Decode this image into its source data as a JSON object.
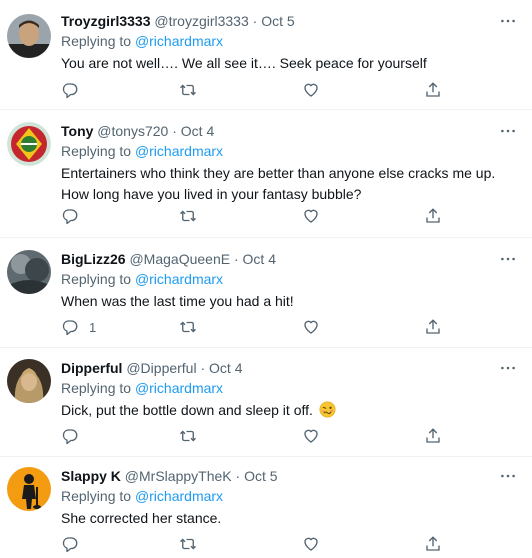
{
  "tweets": [
    {
      "name": "Troyzgirl3333",
      "handle": "@troyzgirl3333",
      "date": "Oct 5",
      "reply_prefix": "Replying to ",
      "mention": "@richardmarx",
      "text": "You are not well…. We all see it…. Seek peace for yourself",
      "reply_count": ""
    },
    {
      "name": "Tony",
      "handle": "@tonys720",
      "date": "Oct 4",
      "reply_prefix": "Replying to ",
      "mention": "@richardmarx",
      "text": "Entertainers who think they are better than anyone else cracks me up. How long have you lived in your fantasy bubble?",
      "reply_count": ""
    },
    {
      "name": "BigLizz26",
      "handle": "@MagaQueenE",
      "date": "Oct 4",
      "reply_prefix": "Replying to ",
      "mention": "@richardmarx",
      "text": "When was the last time you had a hit!",
      "reply_count": "1"
    },
    {
      "name": "Dipperful",
      "handle": "@Dipperful",
      "date": "Oct 4",
      "reply_prefix": "Replying to ",
      "mention": "@richardmarx",
      "text": "Dick, put the bottle down and sleep it off.",
      "reply_count": ""
    },
    {
      "name": "Slappy K",
      "handle": "@MrSlappyTheK",
      "date": "Oct 5",
      "reply_prefix": "Replying to ",
      "mention": "@richardmarx",
      "text": "She corrected her stance.",
      "reply_count": ""
    }
  ],
  "separator": "·",
  "colors": {
    "accent": "#1d9bf0",
    "secondary": "#536471",
    "text": "#0f1419"
  },
  "icons": [
    "more-icon",
    "reply-icon",
    "retweet-icon",
    "like-icon",
    "share-icon",
    "woozy-face-emoji"
  ]
}
